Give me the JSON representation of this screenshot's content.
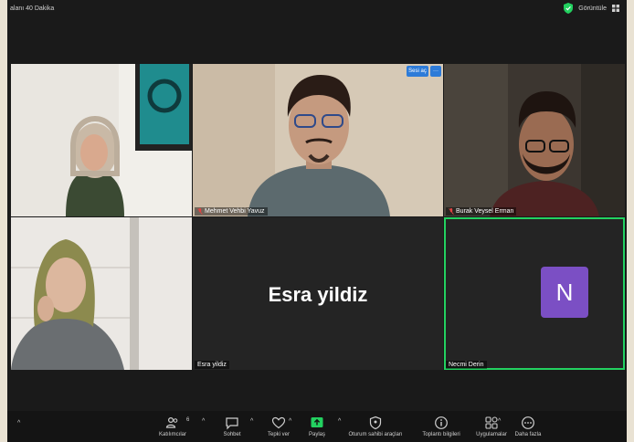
{
  "topbar": {
    "timer_text": "alanı 40 Dakika",
    "view_label": "Görüntüle"
  },
  "tiles": {
    "host_button": "Sesi aç",
    "more_button": "···",
    "speaker_name": "Mehmet Vehbi Yavuz",
    "right_top_name": "Burak Veysel Erman",
    "esra_big": "Esra yildiz",
    "esra_small": "Esra yildiz",
    "necmi_name": "Necmi Derin",
    "necmi_avatar": "N"
  },
  "toolbar": {
    "participants_label": "Katılımcılar",
    "participants_count": "6",
    "chat_label": "Sohbet",
    "react_label": "Tepki ver",
    "share_label": "Paylaş",
    "host_tools_label": "Oturum sahibi araçları",
    "meeting_info_label": "Toplantı bilgileri",
    "apps_label": "Uygulamalar",
    "more_label": "Daha fazla",
    "caret": "^"
  },
  "colors": {
    "share_green": "#23d160",
    "avatar_purple": "#7b4fc4",
    "accent_blue": "#2d7bd8"
  },
  "icons": [
    "shield-icon",
    "grid-icon",
    "mic-off-icon",
    "participants-icon",
    "chat-icon",
    "react-icon",
    "share-icon",
    "host-tools-icon",
    "info-icon",
    "apps-icon",
    "more-icon"
  ]
}
